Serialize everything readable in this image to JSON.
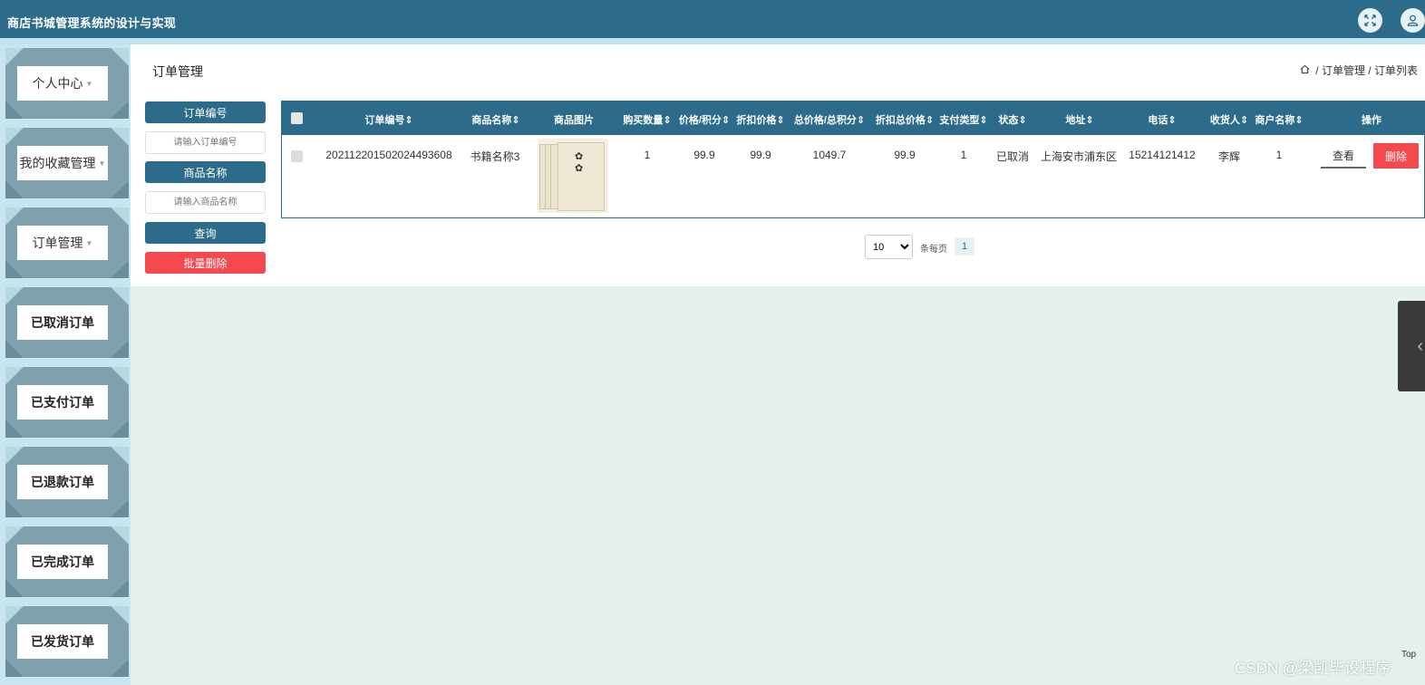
{
  "app": {
    "title": "商店书城管理系统的设计与实现"
  },
  "topbar": {
    "fullscreen_icon": "arrows-expand-icon",
    "user_icon": "user-icon"
  },
  "sidebar": {
    "items": [
      {
        "label": "个人中心",
        "has_caret": true
      },
      {
        "label": "我的收藏管理",
        "has_caret": true
      },
      {
        "label": "订单管理",
        "has_caret": true
      },
      {
        "label": "已取消订单",
        "has_caret": false
      },
      {
        "label": "已支付订单",
        "has_caret": false
      },
      {
        "label": "已退款订单",
        "has_caret": false
      },
      {
        "label": "已完成订单",
        "has_caret": false
      },
      {
        "label": "已发货订单",
        "has_caret": false
      }
    ]
  },
  "page": {
    "title": "订单管理",
    "breadcrumb": {
      "sep": "/",
      "level1": "订单管理",
      "level2": "订单列表"
    }
  },
  "search": {
    "order_no_label": "订单编号",
    "order_no_placeholder": "请输入订单编号",
    "product_label": "商品名称",
    "product_placeholder": "请输入商品名称",
    "query_button": "查询",
    "batch_delete_button": "批量删除"
  },
  "table": {
    "headers": [
      "订单编号",
      "商品名称",
      "商品图片",
      "购买数量",
      "价格/积分",
      "折扣价格",
      "总价格/总积分",
      "折扣总价格",
      "支付类型",
      "状态",
      "地址",
      "电话",
      "收货人",
      "商户名称",
      "操作"
    ],
    "sort_glyph": "⇕",
    "rows": [
      {
        "order_no": "20211220150202449 3608",
        "order_no_display": "20211220150202449360 8",
        "product_name": "书籍名称3",
        "image_alt": "书籍封面",
        "quantity": "1",
        "price": "99.9",
        "discount_price": "99.9",
        "total": "1049.7",
        "discount_total": "99.9",
        "pay_type": "1",
        "status": "已取消",
        "address": "上海安市浦东区",
        "phone": "15214121412",
        "receiver": "李辉",
        "merchant": "1",
        "view_button": "查看",
        "delete_button": "删除"
      }
    ],
    "order_no_text": "20211220150202449 3608"
  },
  "pager": {
    "page_size": "10",
    "per_page_label": "条每页",
    "current_page": "1"
  },
  "footer": {
    "watermark": "CSDN @梁凯毕设程序",
    "top_label": "Top"
  },
  "colors": {
    "primary": "#2c6c8a",
    "danger": "#f5484f",
    "background": "#e5efeb"
  }
}
